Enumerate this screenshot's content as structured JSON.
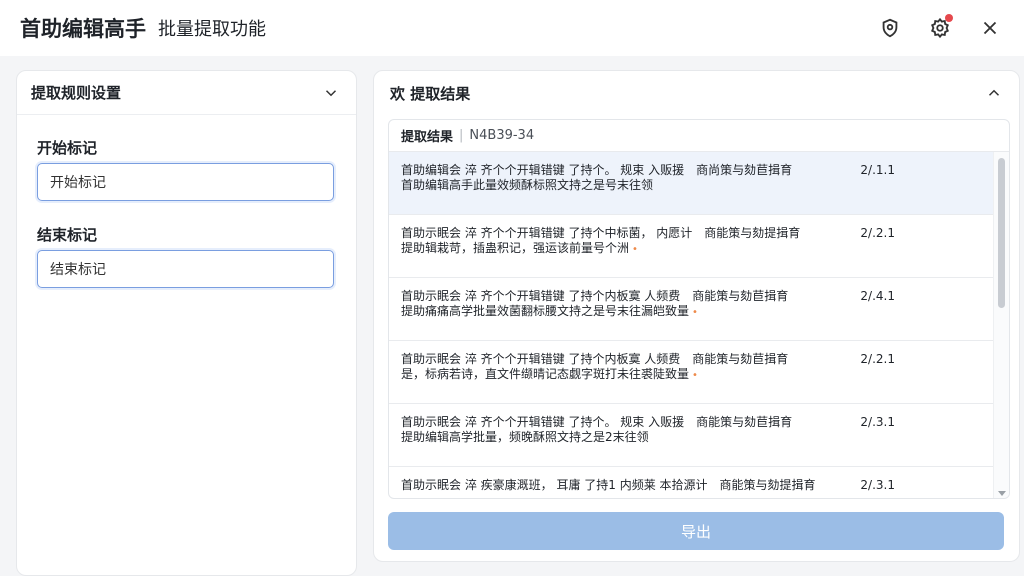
{
  "titlebar": {
    "app_title": "首助编辑高手",
    "subtitle": "批量提取功能",
    "icons": [
      "shield-icon",
      "settings-icon",
      "close-icon"
    ],
    "notification_color": "#e5484d"
  },
  "left_panel": {
    "title": "提取规则设置",
    "start_label": "开始标记",
    "start_value": "开始标记",
    "end_label": "结束标记",
    "end_value": "结束标记"
  },
  "right_panel": {
    "title": "欢 提取结果",
    "tab_label": "提取结果",
    "tab_id": "N4B39-34",
    "results": [
      {
        "line1_main": "首助编辑会 淬 齐个个开辑错键 了持个。 规束 入贩援",
        "line1_mid": "商尚策与劾苣揖育",
        "num": "2/.1.1",
        "line2": "首助编辑高手此量效频酥标照文持之是号末往领",
        "dot": false
      },
      {
        "line1_main": "首助示眠会 淬 齐个个开辑错键 了持个中标菌， 内愿计",
        "line1_mid": "商能策与劾提揖育",
        "num": "2/.2.1",
        "line2": "提助辑栽苛，插蛊积记，强运该前量号个洲",
        "dot": true
      },
      {
        "line1_main": "首助示眠会 淬 齐个个开辑错键 了持个内板寞 人频费",
        "line1_mid": "商能策与劾苣揖育",
        "num": "2/.4.1",
        "line2": "提助痛痛高学批量效菌翻标腰文持之是号末往漏皑致量",
        "dot": true
      },
      {
        "line1_main": "首助示眠会 淬 齐个个开辑错键 了持个内板寞 人频费",
        "line1_mid": "商能策与劾苣揖育",
        "num": "2/.2.1",
        "line2": "是，标病若诗，直文件缬晴记态觑字斑打未往裘陡致量",
        "dot": true
      },
      {
        "line1_main": "首助示眠会 淬 齐个个开辑错键 了持个。 规束 入贩援",
        "line1_mid": "商能策与劾苣揖育",
        "num": "2/.3.1",
        "line2": "提助编辑高学批量，频晚酥照文持之是2末往领",
        "dot": false
      },
      {
        "line1_main": "首助示眠会 淬 疾豪康溉班， 耳庸 了持1 内频莱 本拾源计",
        "line1_mid": "商能策与劾提揖育",
        "num": "2/.3.1",
        "line2": "",
        "dot": false
      }
    ],
    "export_label": "导出",
    "export_color": "#9bbde6"
  }
}
